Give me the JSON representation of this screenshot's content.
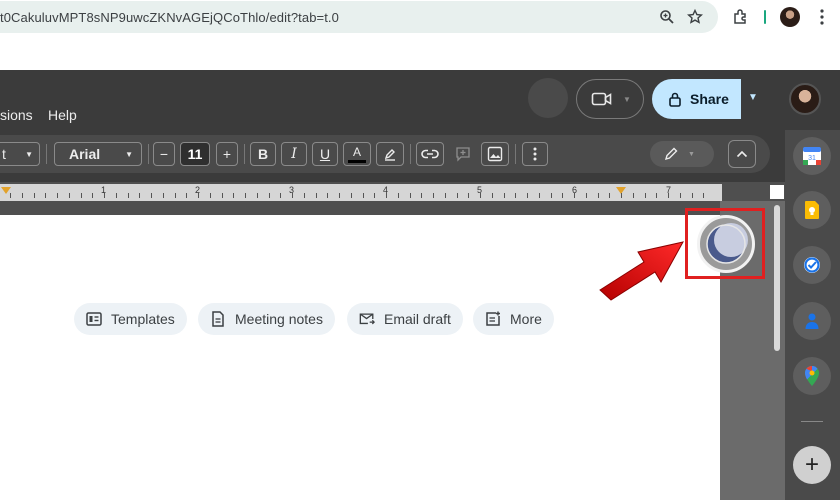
{
  "browser": {
    "url": "t0CakuluvMPT8sNP9uwcZKNvAGEjQCoThlo/edit?tab=t.0",
    "icons": [
      "zoom-icon",
      "bookmark-star-icon",
      "extensions-icon",
      "profile-avatar",
      "kebab-menu-icon"
    ]
  },
  "docs_header": {
    "menu": [
      "sions",
      "Help"
    ],
    "share_label": "Share"
  },
  "toolbar": {
    "style_fragment": "t",
    "font_family": "Arial",
    "font_size": "11",
    "minus": "−",
    "plus": "+",
    "bold": "B",
    "italic": "I",
    "underline": "U",
    "text_color": "A"
  },
  "ruler": {
    "numbers": [
      "1",
      "2",
      "3",
      "4",
      "5",
      "6",
      "7"
    ]
  },
  "document": {
    "chips": [
      {
        "label": "Templates",
        "icon": "templates-icon"
      },
      {
        "label": "Meeting notes",
        "icon": "document-icon"
      },
      {
        "label": "Email draft",
        "icon": "email-draft-icon"
      },
      {
        "label": "More",
        "icon": "more-icon"
      }
    ]
  },
  "side_panel": {
    "apps": [
      "calendar-icon",
      "keep-icon",
      "tasks-icon",
      "contacts-icon",
      "maps-icon"
    ],
    "add_label": "+"
  },
  "colors": {
    "header_bg": "#3b3b3b",
    "share_bg": "#c2e7ff",
    "highlight": "#e02020"
  }
}
